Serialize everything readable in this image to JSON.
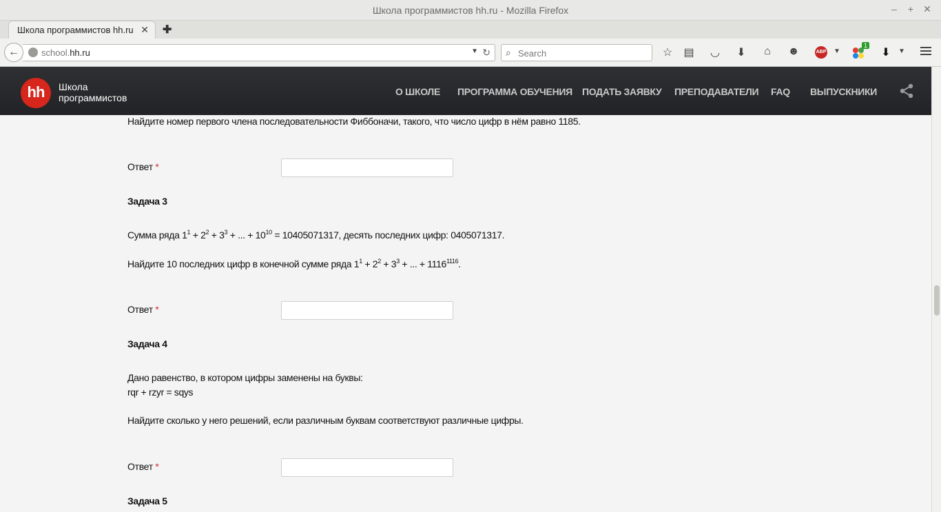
{
  "window": {
    "title": "Школа программистов hh.ru - Mozilla Firefox",
    "controls": [
      "–",
      "+",
      "✕"
    ]
  },
  "tab": {
    "label": "Школа программистов hh.ru",
    "close": "✕",
    "new_tab": "✚"
  },
  "navbar": {
    "url_prefix": "school.",
    "url_domain": "hh.ru",
    "search_placeholder": "Search",
    "extension_badge": "1",
    "adblock_label": "ABP",
    "icons": [
      "back-icon",
      "bookmark-star-icon",
      "reading-list-icon",
      "pocket-icon",
      "download-icon",
      "home-icon",
      "chat-icon",
      "adblock-icon",
      "extension-icon",
      "download-arrow-icon",
      "menu-icon"
    ]
  },
  "site": {
    "logo": "hh",
    "name_line1": "Школа",
    "name_line2": "программистов",
    "nav": [
      "О ШКОЛЕ",
      "ПРОГРАММА ОБУЧЕНИЯ",
      "ПОДАТЬ ЗАЯВКУ",
      "ПРЕПОДАВАТЕЛИ",
      "FAQ",
      "ВЫПУСКНИКИ"
    ]
  },
  "content": {
    "task2_question": "Найдите номер первого члена последовательности Фиббоначи, такого, что число цифр в нём равно 1185.",
    "answer_label": "Ответ",
    "required_mark": "*",
    "task3": {
      "heading": "Задача 3",
      "line1_prefix": "Сумма ряда 1",
      "line1_suffix": " = 10405071317, десять последних цифр: 0405071317.",
      "line2_prefix": "Найдите 10 последних цифр в конечной сумме ряда 1",
      "line2_suffix": "."
    },
    "task4": {
      "heading": "Задача 4",
      "line1": "Дано равенство, в котором цифры заменены на буквы:",
      "line2": "rqr + rzyr = sqys",
      "line3": "Найдите сколько у него решений, если различным буквам соответствуют различные цифры."
    },
    "task5": {
      "heading": "Задача 5"
    }
  }
}
